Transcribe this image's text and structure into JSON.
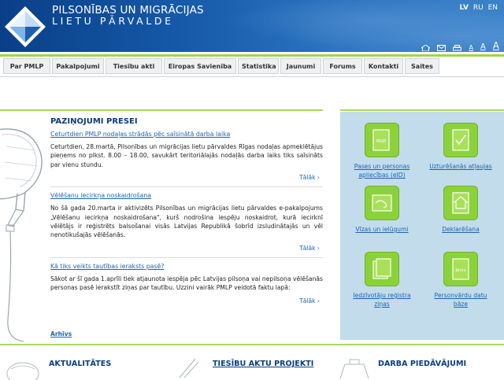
{
  "header": {
    "brand_line1": "PILSONĪBAS UN MIGRĀCIJAS",
    "brand_line2": "LIETU PĀRVALDE",
    "languages": [
      "LV",
      "RU",
      "EN"
    ],
    "tools": {
      "home_icon": "home-icon",
      "mail_icon": "mail-icon",
      "print_icon": "print-icon",
      "text_small": "A",
      "text_medium": "A",
      "text_large": "A"
    }
  },
  "nav": {
    "items": [
      "Par PMLP",
      "Pakalpojumi",
      "Tiesību akti",
      "Eiropas Savienība",
      "Statistika",
      "Jaunumi",
      "Forums",
      "Kontakti",
      "Saites"
    ]
  },
  "news": {
    "heading": "PAZIŅOJUMI PRESEI",
    "articles": [
      {
        "title": "Ceturtdien PMLP nodaļas strādās pēc saīsinātā darba laika",
        "body": "Ceturtdien, 28.martā, Pilsonības un migrācijas lietu pārvaldes Rīgas nodaļas apmeklētājus pieņems no plkst. 8.00 – 18.00, savukārt teritoriālajās nodaļās darba laiks tiks saīsināts par vienu stundu.",
        "more": "Tālāk"
      },
      {
        "title": "Vēlēšanu iecirkņa noskaidrošana",
        "body": "No šā gada 20.marta ir aktivizēts Pilsonības un migrācijas lietu pārvaldes e-pakalpojums „Vēlēšanu iecirkņa noskaidrošana\", kurš nodrošina iespēju noskaidrot, kurā iecirknī vēlētājs ir reģistrēts balsošanai visās Latvijas Republikā šobrīd izsludinātajās un vēl nenotikušajās vēlēšanās.",
        "more": "Tālāk"
      },
      {
        "title": "Kā tiks veikts tautības ieraksts pasē?",
        "body": "Sākot ar šī gada 1.aprīli tiek atjaunota iespēja pēc Latvijas pilsoņa vai nepilsoņa vēlēšanās personas pasē ierakstīt ziņas par tautību. Uzzini vairāk PMLP veidotā faktu lapā:",
        "more": "Tālāk"
      }
    ],
    "archive": "Arhīvs"
  },
  "services": [
    {
      "label": "Pases un personas apliecības (eID)",
      "icon": "passport-icon",
      "badge": "PASE"
    },
    {
      "label": "Uzturēšanās atļaujas",
      "icon": "residence-permit-icon",
      "badge": ""
    },
    {
      "label": "Vīzas un ielūgumi",
      "icon": "visa-icon",
      "badge": ""
    },
    {
      "label": "Deklarēšana",
      "icon": "declaration-icon",
      "badge": ""
    },
    {
      "label": "Iedzīvotāju reģistra ziņas",
      "icon": "register-icon",
      "badge": ""
    },
    {
      "label": "Personvārdu datu bāze",
      "icon": "names-database-icon",
      "badge": "Jānis"
    }
  ],
  "bottom": {
    "news": "AKTUALITĀTES",
    "legal": "TIESĪBU AKTU PROJEKTI",
    "offers": "DARBA PIEDĀVĀJUMI"
  },
  "colors": {
    "header_dark": "#0a3f87",
    "accent_green": "#9fd44a",
    "link_blue": "#1f62b3",
    "heading_blue": "#0b3d80",
    "panel_bg": "#c2dceb"
  }
}
